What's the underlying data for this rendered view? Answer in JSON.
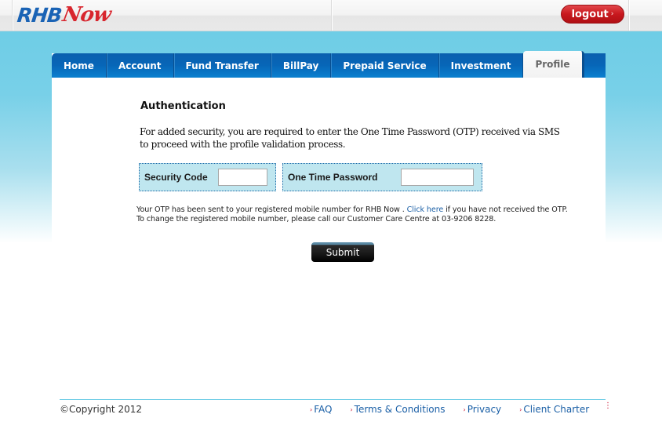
{
  "header": {
    "logo_primary": "RHB",
    "logo_secondary": "Now",
    "logout_label": "logout",
    "logout_icon": "chevron-right-icon"
  },
  "nav": {
    "items": [
      {
        "label": "Home",
        "active": false
      },
      {
        "label": "Account",
        "active": false
      },
      {
        "label": "Fund Transfer",
        "active": false
      },
      {
        "label": "BillPay",
        "active": false
      },
      {
        "label": "Prepaid Service",
        "active": false
      },
      {
        "label": "Investment",
        "active": false
      },
      {
        "label": "Profile",
        "active": true
      }
    ]
  },
  "main": {
    "title": "Authentication",
    "intro": "For added security, you are required to enter the One Time Password (OTP) received via SMS to proceed with the profile validation process.",
    "security_code": {
      "label": "Security Code",
      "value": ""
    },
    "otp": {
      "label": "One Time Password",
      "value": ""
    },
    "note_part1": "Your OTP has been sent to your registered mobile number for RHB Now .",
    "note_link": "Click here",
    "note_part2": "if you have not received the OTP. To change the registered mobile number, please call our Customer Care Centre at 03-9206 8228.",
    "submit_label": "Submit"
  },
  "footer": {
    "copyright": "©Copyright 2012",
    "links": [
      {
        "label": "FAQ"
      },
      {
        "label": "Terms & Conditions"
      },
      {
        "label": "Privacy"
      },
      {
        "label": "Client Charter"
      }
    ]
  },
  "colors": {
    "brand_blue": "#1a63b5",
    "brand_red": "#d8262e",
    "nav_blue": "#0766b8",
    "sky": "#6ecde6",
    "field_bg": "#bfe6ef",
    "link": "#1a5fa6"
  }
}
